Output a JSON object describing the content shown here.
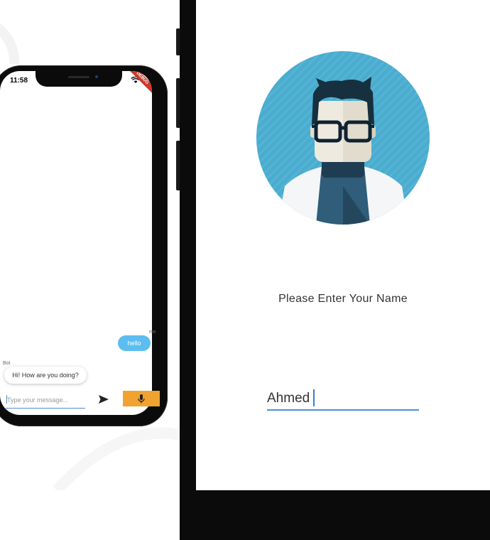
{
  "chat_phone": {
    "status_time": "11:58",
    "status_icons": "wifi-icon",
    "debug_banner": "DEBUG",
    "messages": [
      {
        "sender": "me",
        "text": "hello"
      },
      {
        "sender": "Bot",
        "text": "Hi! How are you doing?"
      }
    ],
    "input": {
      "placeholder": "Type your message...",
      "value": ""
    },
    "send_icon": "send-icon",
    "mic_icon": "mic-icon",
    "colors": {
      "user_bubble": "#5bbdf0",
      "mic_button": "#f0a330",
      "accent": "#4a90d9"
    }
  },
  "name_phone": {
    "avatar": "avatar-illustration",
    "prompt": "Please Enter Your Name",
    "name_input": {
      "value": "Ahmed"
    },
    "colors": {
      "avatar_bg": "#4aaccf",
      "underline": "#4a90d9"
    }
  }
}
